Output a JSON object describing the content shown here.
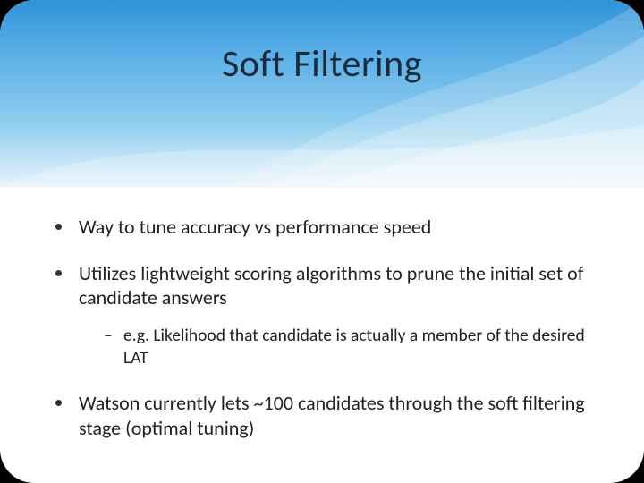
{
  "slide": {
    "title": "Soft Filtering",
    "bullets": [
      {
        "text": "Way to tune accuracy vs performance speed"
      },
      {
        "text": "Utilizes lightweight scoring algorithms to prune the initial set of candidate answers",
        "sub": [
          {
            "text": "e.g. Likelihood that candidate is actually a member of the desired LAT"
          }
        ]
      },
      {
        "text": "Watson currently lets ~100 candidates through the soft filtering stage (optimal tuning)"
      }
    ]
  }
}
